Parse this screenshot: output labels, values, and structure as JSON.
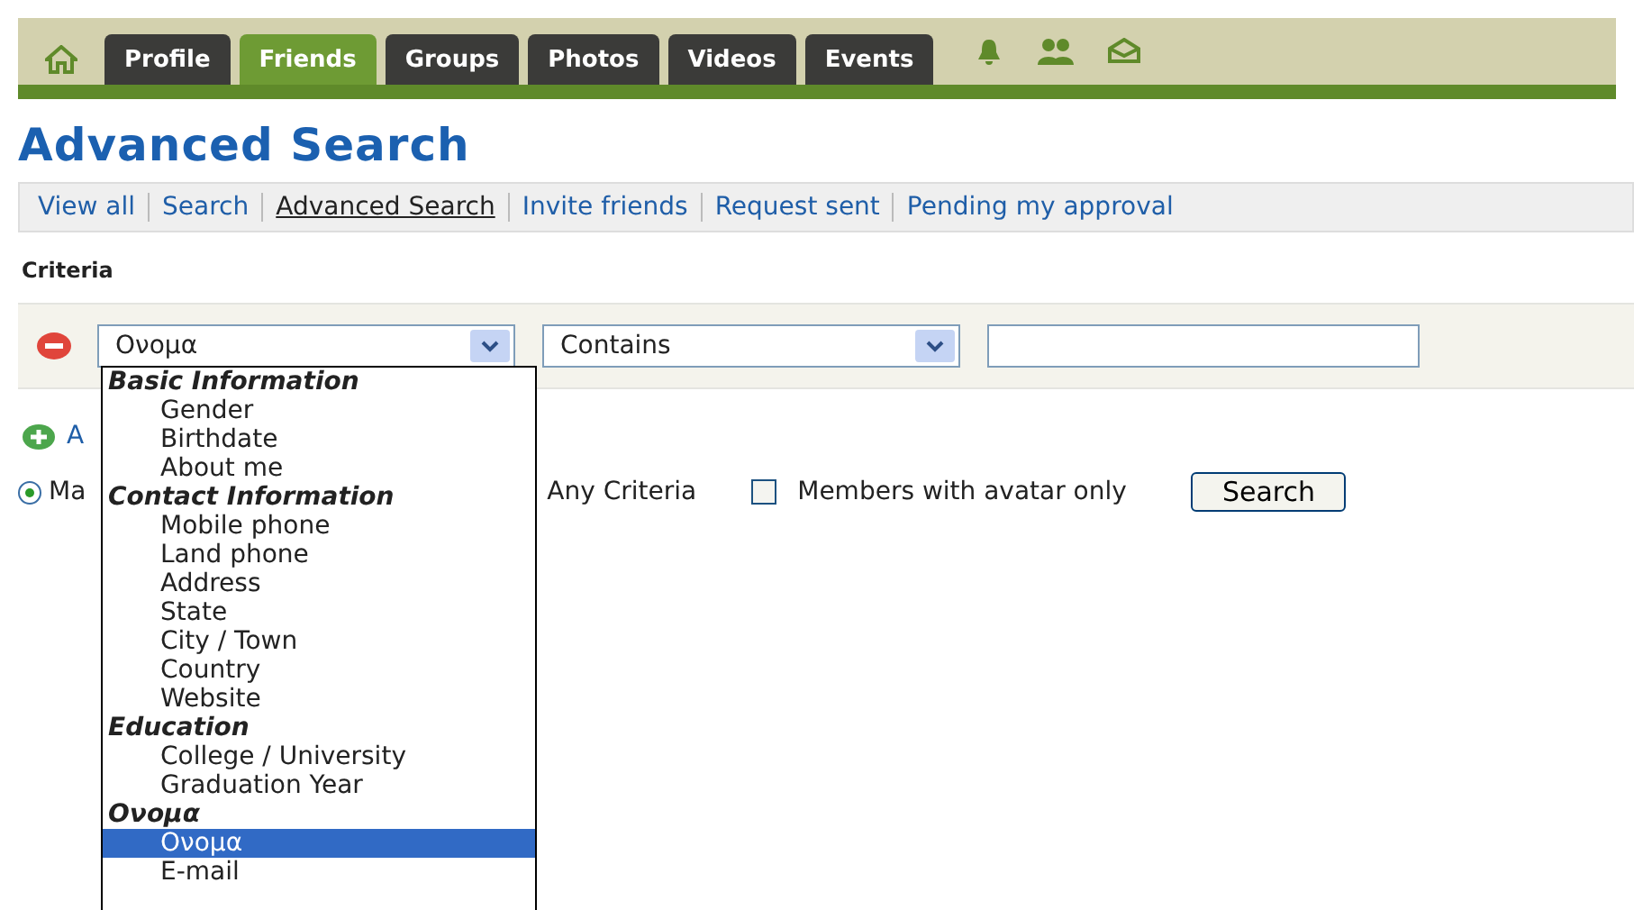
{
  "nav": {
    "tabs": [
      {
        "kind": "home",
        "selected": false
      },
      {
        "label": "Profile",
        "selected": false
      },
      {
        "label": "Friends",
        "selected": true
      },
      {
        "label": "Groups",
        "selected": false
      },
      {
        "label": "Photos",
        "selected": false
      },
      {
        "label": "Videos",
        "selected": false
      },
      {
        "label": "Events",
        "selected": false
      }
    ]
  },
  "title": "Advanced Search",
  "subnav": [
    {
      "label": "View all",
      "selected": false
    },
    {
      "label": "Search",
      "selected": false
    },
    {
      "label": "Advanced Search",
      "selected": true
    },
    {
      "label": "Invite friends",
      "selected": false
    },
    {
      "label": "Request sent",
      "selected": false
    },
    {
      "label": "Pending my approval",
      "selected": false
    }
  ],
  "criteria_label": "Criteria",
  "criterion": {
    "field": "Ονομα",
    "condition": "Contains"
  },
  "add_link": "A",
  "options": {
    "match_all": {
      "label": "Ma",
      "selected": true
    },
    "match_any": {
      "label": "Any Criteria"
    },
    "avatar_only": {
      "label": "Members with avatar only",
      "checked": false
    },
    "button": "Search"
  },
  "dropdown": [
    {
      "kind": "group",
      "label": "Basic Information"
    },
    {
      "kind": "option",
      "label": "Gender",
      "selected": false
    },
    {
      "kind": "option",
      "label": "Birthdate",
      "selected": false
    },
    {
      "kind": "option",
      "label": "About me",
      "selected": false
    },
    {
      "kind": "group",
      "label": "Contact Information"
    },
    {
      "kind": "option",
      "label": "Mobile phone",
      "selected": false
    },
    {
      "kind": "option",
      "label": "Land phone",
      "selected": false
    },
    {
      "kind": "option",
      "label": "Address",
      "selected": false
    },
    {
      "kind": "option",
      "label": "State",
      "selected": false
    },
    {
      "kind": "option",
      "label": "City / Town",
      "selected": false
    },
    {
      "kind": "option",
      "label": "Country",
      "selected": false
    },
    {
      "kind": "option",
      "label": "Website",
      "selected": false
    },
    {
      "kind": "group",
      "label": "Education"
    },
    {
      "kind": "option",
      "label": "College / University",
      "selected": false
    },
    {
      "kind": "option",
      "label": "Graduation Year",
      "selected": false
    },
    {
      "kind": "group",
      "label": "Ονομα"
    },
    {
      "kind": "option",
      "label": "Ονομα",
      "selected": true
    },
    {
      "kind": "option",
      "label": "E-mail",
      "selected": false
    }
  ]
}
